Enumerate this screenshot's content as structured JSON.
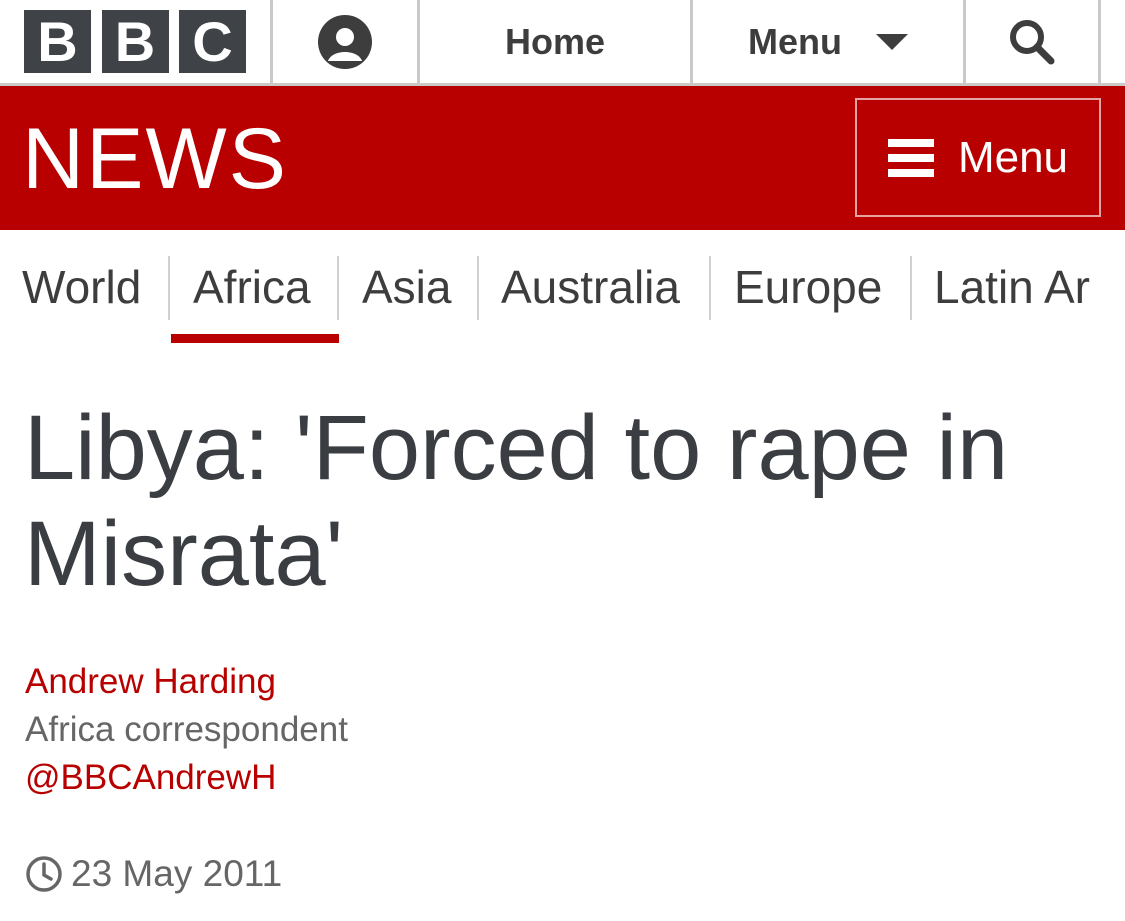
{
  "topbar": {
    "logo_letters": [
      "B",
      "B",
      "C"
    ],
    "account_icon": "account-icon",
    "home_label": "Home",
    "menu_label": "Menu",
    "menu_icon": "caret-down-icon",
    "search_icon": "search-icon"
  },
  "newsbar": {
    "title": "NEWS",
    "menu_label": "Menu",
    "menu_icon": "hamburger-icon",
    "brand_color": "#b80000"
  },
  "sections": {
    "items": [
      "World",
      "Africa",
      "Asia",
      "Australia",
      "Europe",
      "Latin Ar"
    ],
    "active": "Africa"
  },
  "article": {
    "headline": "Libya: 'Forced to rape in Misrata'",
    "author": "Andrew Harding",
    "role": "Africa correspondent",
    "twitter": "@BBCAndrewH",
    "date_icon": "clock-icon",
    "date": "23 May 2011"
  }
}
